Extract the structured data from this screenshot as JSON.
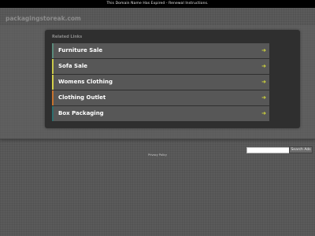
{
  "banner": {
    "text": "This Domain Name Has Expired - Renewal Instructions."
  },
  "header": {
    "domain": "packagingstoreak.com"
  },
  "related": {
    "heading": "Related Links",
    "links": [
      {
        "label": "Furniture Sale",
        "accent": "#5a8a7a"
      },
      {
        "label": "Sofa Sale",
        "accent": "#c9c84a"
      },
      {
        "label": "Womens Clothing",
        "accent": "#d4d04a"
      },
      {
        "label": "Clothing Outlet",
        "accent": "#c7732e"
      },
      {
        "label": "Box Packaging",
        "accent": "#2e6e6e"
      }
    ],
    "arrow_icon": "arrow-right-icon",
    "arrow_color": "#d4d93a"
  },
  "search": {
    "button_label": "Search Ads",
    "placeholder": ""
  },
  "footer": {
    "privacy_label": "Privacy Policy"
  }
}
